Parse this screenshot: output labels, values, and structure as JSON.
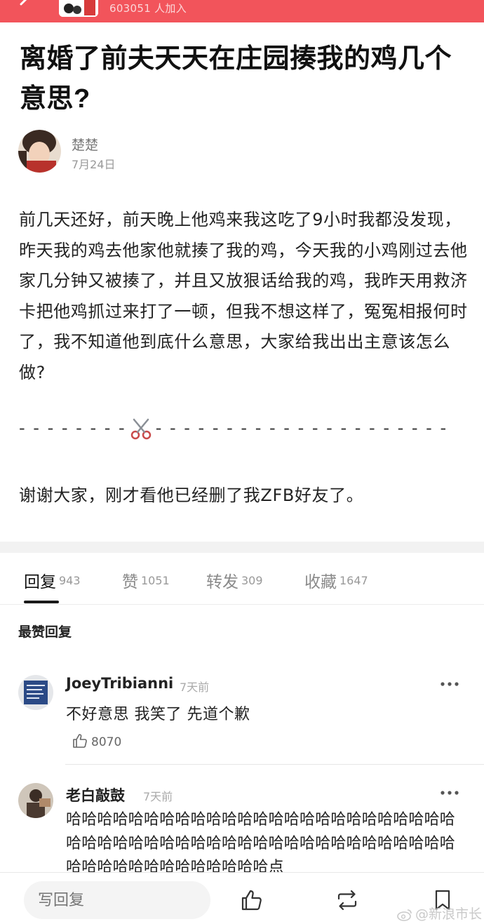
{
  "header": {
    "members_text": "603051 人加入",
    "accent_color": "#f2545b"
  },
  "post": {
    "title": "离婚了前夫天天在庄园揍我的鸡几个意思?",
    "author": "楚楚",
    "date": "7月24日",
    "body": "前几天还好，前天晚上他鸡来我这吃了9小时我都没发现，昨天我的鸡去他家他就揍了我的鸡，今天我的小鸡刚过去他家几分钟又被揍了，并且又放狠话给我的鸡，我昨天用救济卡把他鸡抓过来打了一顿，但我不想这样了，冤冤相报何时了，我不知道他到底什么意思，大家给我出出主意该怎么做?",
    "cut_left": "- - - - - - - -",
    "cut_right": "- - - - - - - - - - - - - - - - - - - - -",
    "thanks": "谢谢大家，刚才看他已经删了我ZFB好友了。"
  },
  "tabs": [
    {
      "label": "回复",
      "count": "943"
    },
    {
      "label": "赞",
      "count": "1051"
    },
    {
      "label": "转发",
      "count": "309"
    },
    {
      "label": "收藏",
      "count": "1647"
    }
  ],
  "section_title": "最赞回复",
  "comments": [
    {
      "name": "JoeyTribianni",
      "time": "7天前",
      "text": "不好意思 我笑了 先道个歉",
      "likes": "8070"
    },
    {
      "name": "老白敲鼓",
      "time": "7天前",
      "text": "哈哈哈哈哈哈哈哈哈哈哈哈哈哈哈哈哈哈哈哈哈哈哈哈哈哈哈哈哈哈哈哈哈哈哈哈哈哈哈哈哈哈哈哈哈哈哈哈哈哈哈哈哈哈哈哈哈哈哈哈哈哈哈点"
    }
  ],
  "bottom_bar": {
    "reply_placeholder": "写回复"
  },
  "watermark": "@新浪市长"
}
